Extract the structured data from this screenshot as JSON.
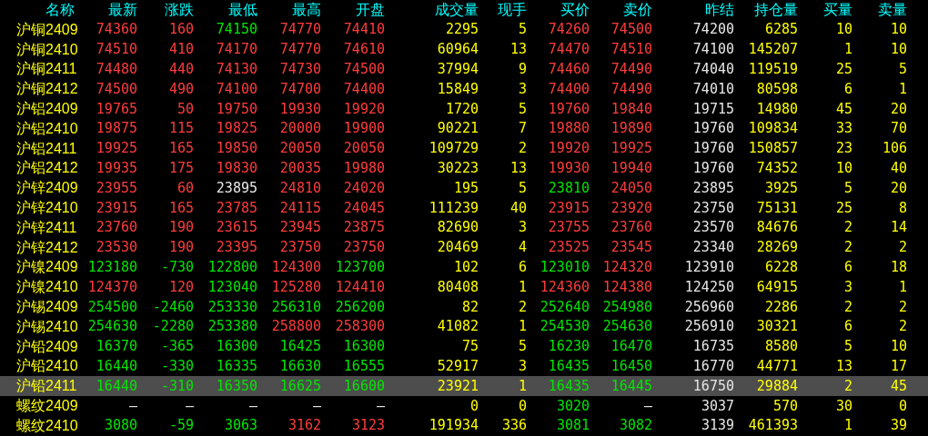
{
  "columns": [
    {
      "label": "名称",
      "kind": "name"
    },
    {
      "label": "最新",
      "kind": "price"
    },
    {
      "label": "涨跌",
      "kind": "price"
    },
    {
      "label": "最低",
      "kind": "price"
    },
    {
      "label": "最高",
      "kind": "price"
    },
    {
      "label": "开盘",
      "kind": "price"
    },
    {
      "label": "成交量",
      "kind": "qty"
    },
    {
      "label": "现手",
      "kind": "qty"
    },
    {
      "label": "买价",
      "kind": "price"
    },
    {
      "label": "卖价",
      "kind": "price"
    },
    {
      "label": "昨结",
      "kind": "ref"
    },
    {
      "label": "持仓量",
      "kind": "qty"
    },
    {
      "label": "买量",
      "kind": "qty"
    },
    {
      "label": "卖量",
      "kind": "qty"
    }
  ],
  "rows": [
    {
      "name": "沪铜2409",
      "selected": false,
      "cells": [
        {
          "text": "74360",
          "color": "#ff3c3c"
        },
        {
          "text": "160",
          "color": "#ff3c3c"
        },
        {
          "text": "74150",
          "color": "#00e600"
        },
        {
          "text": "74770",
          "color": "#ff3c3c"
        },
        {
          "text": "74410",
          "color": "#ff3c3c"
        },
        {
          "text": "2295"
        },
        {
          "text": "5"
        },
        {
          "text": "74260",
          "color": "#ff3c3c"
        },
        {
          "text": "74500",
          "color": "#ff3c3c"
        },
        {
          "text": "74200"
        },
        {
          "text": "6285"
        },
        {
          "text": "10"
        },
        {
          "text": "10"
        }
      ]
    },
    {
      "name": "沪铜2410",
      "selected": false,
      "cells": [
        {
          "text": "74510",
          "color": "#ff3c3c"
        },
        {
          "text": "410",
          "color": "#ff3c3c"
        },
        {
          "text": "74170",
          "color": "#ff3c3c"
        },
        {
          "text": "74770",
          "color": "#ff3c3c"
        },
        {
          "text": "74610",
          "color": "#ff3c3c"
        },
        {
          "text": "60964"
        },
        {
          "text": "13"
        },
        {
          "text": "74470",
          "color": "#ff3c3c"
        },
        {
          "text": "74510",
          "color": "#ff3c3c"
        },
        {
          "text": "74100"
        },
        {
          "text": "145207"
        },
        {
          "text": "1"
        },
        {
          "text": "10"
        }
      ]
    },
    {
      "name": "沪铜2411",
      "selected": false,
      "cells": [
        {
          "text": "74480",
          "color": "#ff3c3c"
        },
        {
          "text": "440",
          "color": "#ff3c3c"
        },
        {
          "text": "74130",
          "color": "#ff3c3c"
        },
        {
          "text": "74730",
          "color": "#ff3c3c"
        },
        {
          "text": "74500",
          "color": "#ff3c3c"
        },
        {
          "text": "37994"
        },
        {
          "text": "9"
        },
        {
          "text": "74460",
          "color": "#ff3c3c"
        },
        {
          "text": "74490",
          "color": "#ff3c3c"
        },
        {
          "text": "74040"
        },
        {
          "text": "119519"
        },
        {
          "text": "25"
        },
        {
          "text": "5"
        }
      ]
    },
    {
      "name": "沪铜2412",
      "selected": false,
      "cells": [
        {
          "text": "74500",
          "color": "#ff3c3c"
        },
        {
          "text": "490",
          "color": "#ff3c3c"
        },
        {
          "text": "74100",
          "color": "#ff3c3c"
        },
        {
          "text": "74700",
          "color": "#ff3c3c"
        },
        {
          "text": "74400",
          "color": "#ff3c3c"
        },
        {
          "text": "15849"
        },
        {
          "text": "3"
        },
        {
          "text": "74400",
          "color": "#ff3c3c"
        },
        {
          "text": "74490",
          "color": "#ff3c3c"
        },
        {
          "text": "74010"
        },
        {
          "text": "80598"
        },
        {
          "text": "6"
        },
        {
          "text": "1"
        }
      ]
    },
    {
      "name": "沪铝2409",
      "selected": false,
      "cells": [
        {
          "text": "19765",
          "color": "#ff3c3c"
        },
        {
          "text": "50",
          "color": "#ff3c3c"
        },
        {
          "text": "19750",
          "color": "#ff3c3c"
        },
        {
          "text": "19930",
          "color": "#ff3c3c"
        },
        {
          "text": "19920",
          "color": "#ff3c3c"
        },
        {
          "text": "1720"
        },
        {
          "text": "5"
        },
        {
          "text": "19760",
          "color": "#ff3c3c"
        },
        {
          "text": "19840",
          "color": "#ff3c3c"
        },
        {
          "text": "19715"
        },
        {
          "text": "14980"
        },
        {
          "text": "45"
        },
        {
          "text": "20"
        }
      ]
    },
    {
      "name": "沪铝2410",
      "selected": false,
      "cells": [
        {
          "text": "19875",
          "color": "#ff3c3c"
        },
        {
          "text": "115",
          "color": "#ff3c3c"
        },
        {
          "text": "19825",
          "color": "#ff3c3c"
        },
        {
          "text": "20000",
          "color": "#ff3c3c"
        },
        {
          "text": "19900",
          "color": "#ff3c3c"
        },
        {
          "text": "90221"
        },
        {
          "text": "7"
        },
        {
          "text": "19880",
          "color": "#ff3c3c"
        },
        {
          "text": "19890",
          "color": "#ff3c3c"
        },
        {
          "text": "19760"
        },
        {
          "text": "109834"
        },
        {
          "text": "33"
        },
        {
          "text": "70"
        }
      ]
    },
    {
      "name": "沪铝2411",
      "selected": false,
      "cells": [
        {
          "text": "19925",
          "color": "#ff3c3c"
        },
        {
          "text": "165",
          "color": "#ff3c3c"
        },
        {
          "text": "19850",
          "color": "#ff3c3c"
        },
        {
          "text": "20050",
          "color": "#ff3c3c"
        },
        {
          "text": "20050",
          "color": "#ff3c3c"
        },
        {
          "text": "109729"
        },
        {
          "text": "2"
        },
        {
          "text": "19920",
          "color": "#ff3c3c"
        },
        {
          "text": "19925",
          "color": "#ff3c3c"
        },
        {
          "text": "19760"
        },
        {
          "text": "150857"
        },
        {
          "text": "23"
        },
        {
          "text": "106"
        }
      ]
    },
    {
      "name": "沪铝2412",
      "selected": false,
      "cells": [
        {
          "text": "19935",
          "color": "#ff3c3c"
        },
        {
          "text": "175",
          "color": "#ff3c3c"
        },
        {
          "text": "19830",
          "color": "#ff3c3c"
        },
        {
          "text": "20035",
          "color": "#ff3c3c"
        },
        {
          "text": "19980",
          "color": "#ff3c3c"
        },
        {
          "text": "30223"
        },
        {
          "text": "13"
        },
        {
          "text": "19930",
          "color": "#ff3c3c"
        },
        {
          "text": "19940",
          "color": "#ff3c3c"
        },
        {
          "text": "19760"
        },
        {
          "text": "74352"
        },
        {
          "text": "10"
        },
        {
          "text": "40"
        }
      ]
    },
    {
      "name": "沪锌2409",
      "selected": false,
      "cells": [
        {
          "text": "23955",
          "color": "#ff3c3c"
        },
        {
          "text": "60",
          "color": "#ff3c3c"
        },
        {
          "text": "23895",
          "color": "#e6e6e6"
        },
        {
          "text": "24810",
          "color": "#ff3c3c"
        },
        {
          "text": "24020",
          "color": "#ff3c3c"
        },
        {
          "text": "195"
        },
        {
          "text": "5"
        },
        {
          "text": "23810",
          "color": "#00e600"
        },
        {
          "text": "24050",
          "color": "#ff3c3c"
        },
        {
          "text": "23895"
        },
        {
          "text": "3925"
        },
        {
          "text": "5"
        },
        {
          "text": "20"
        }
      ]
    },
    {
      "name": "沪锌2410",
      "selected": false,
      "cells": [
        {
          "text": "23915",
          "color": "#ff3c3c"
        },
        {
          "text": "165",
          "color": "#ff3c3c"
        },
        {
          "text": "23785",
          "color": "#ff3c3c"
        },
        {
          "text": "24115",
          "color": "#ff3c3c"
        },
        {
          "text": "24045",
          "color": "#ff3c3c"
        },
        {
          "text": "111239"
        },
        {
          "text": "40"
        },
        {
          "text": "23915",
          "color": "#ff3c3c"
        },
        {
          "text": "23920",
          "color": "#ff3c3c"
        },
        {
          "text": "23750"
        },
        {
          "text": "75131"
        },
        {
          "text": "25"
        },
        {
          "text": "8"
        }
      ]
    },
    {
      "name": "沪锌2411",
      "selected": false,
      "cells": [
        {
          "text": "23760",
          "color": "#ff3c3c"
        },
        {
          "text": "190",
          "color": "#ff3c3c"
        },
        {
          "text": "23615",
          "color": "#ff3c3c"
        },
        {
          "text": "23945",
          "color": "#ff3c3c"
        },
        {
          "text": "23875",
          "color": "#ff3c3c"
        },
        {
          "text": "82690"
        },
        {
          "text": "3"
        },
        {
          "text": "23755",
          "color": "#ff3c3c"
        },
        {
          "text": "23760",
          "color": "#ff3c3c"
        },
        {
          "text": "23570"
        },
        {
          "text": "84676"
        },
        {
          "text": "2"
        },
        {
          "text": "14"
        }
      ]
    },
    {
      "name": "沪锌2412",
      "selected": false,
      "cells": [
        {
          "text": "23530",
          "color": "#ff3c3c"
        },
        {
          "text": "190",
          "color": "#ff3c3c"
        },
        {
          "text": "23395",
          "color": "#ff3c3c"
        },
        {
          "text": "23750",
          "color": "#ff3c3c"
        },
        {
          "text": "23750",
          "color": "#ff3c3c"
        },
        {
          "text": "20469"
        },
        {
          "text": "4"
        },
        {
          "text": "23525",
          "color": "#ff3c3c"
        },
        {
          "text": "23545",
          "color": "#ff3c3c"
        },
        {
          "text": "23340"
        },
        {
          "text": "28269"
        },
        {
          "text": "2"
        },
        {
          "text": "2"
        }
      ]
    },
    {
      "name": "沪镍2409",
      "selected": false,
      "cells": [
        {
          "text": "123180",
          "color": "#00e600"
        },
        {
          "text": "-730",
          "color": "#00e600"
        },
        {
          "text": "122800",
          "color": "#00e600"
        },
        {
          "text": "124300",
          "color": "#ff3c3c"
        },
        {
          "text": "123700",
          "color": "#00e600"
        },
        {
          "text": "102"
        },
        {
          "text": "6"
        },
        {
          "text": "123010",
          "color": "#00e600"
        },
        {
          "text": "124320",
          "color": "#ff3c3c"
        },
        {
          "text": "123910"
        },
        {
          "text": "6228"
        },
        {
          "text": "6"
        },
        {
          "text": "18"
        }
      ]
    },
    {
      "name": "沪镍2410",
      "selected": false,
      "cells": [
        {
          "text": "124370",
          "color": "#ff3c3c"
        },
        {
          "text": "120",
          "color": "#ff3c3c"
        },
        {
          "text": "123040",
          "color": "#00e600"
        },
        {
          "text": "125280",
          "color": "#ff3c3c"
        },
        {
          "text": "124410",
          "color": "#ff3c3c"
        },
        {
          "text": "80408"
        },
        {
          "text": "1"
        },
        {
          "text": "124360",
          "color": "#ff3c3c"
        },
        {
          "text": "124380",
          "color": "#ff3c3c"
        },
        {
          "text": "124250"
        },
        {
          "text": "64915"
        },
        {
          "text": "3"
        },
        {
          "text": "1"
        }
      ]
    },
    {
      "name": "沪锡2409",
      "selected": false,
      "cells": [
        {
          "text": "254500",
          "color": "#00e600"
        },
        {
          "text": "-2460",
          "color": "#00e600"
        },
        {
          "text": "253330",
          "color": "#00e600"
        },
        {
          "text": "256310",
          "color": "#00e600"
        },
        {
          "text": "256200",
          "color": "#00e600"
        },
        {
          "text": "82"
        },
        {
          "text": "2"
        },
        {
          "text": "252640",
          "color": "#00e600"
        },
        {
          "text": "254980",
          "color": "#00e600"
        },
        {
          "text": "256960"
        },
        {
          "text": "2286"
        },
        {
          "text": "2"
        },
        {
          "text": "2"
        }
      ]
    },
    {
      "name": "沪锡2410",
      "selected": false,
      "cells": [
        {
          "text": "254630",
          "color": "#00e600"
        },
        {
          "text": "-2280",
          "color": "#00e600"
        },
        {
          "text": "253380",
          "color": "#00e600"
        },
        {
          "text": "258800",
          "color": "#ff3c3c"
        },
        {
          "text": "258300",
          "color": "#ff3c3c"
        },
        {
          "text": "41082"
        },
        {
          "text": "1"
        },
        {
          "text": "254530",
          "color": "#00e600"
        },
        {
          "text": "254630",
          "color": "#00e600"
        },
        {
          "text": "256910"
        },
        {
          "text": "30321"
        },
        {
          "text": "6"
        },
        {
          "text": "2"
        }
      ]
    },
    {
      "name": "沪铅2409",
      "selected": false,
      "cells": [
        {
          "text": "16370",
          "color": "#00e600"
        },
        {
          "text": "-365",
          "color": "#00e600"
        },
        {
          "text": "16300",
          "color": "#00e600"
        },
        {
          "text": "16425",
          "color": "#00e600"
        },
        {
          "text": "16300",
          "color": "#00e600"
        },
        {
          "text": "75"
        },
        {
          "text": "5"
        },
        {
          "text": "16230",
          "color": "#00e600"
        },
        {
          "text": "16470",
          "color": "#00e600"
        },
        {
          "text": "16735"
        },
        {
          "text": "8580"
        },
        {
          "text": "5"
        },
        {
          "text": "10"
        }
      ]
    },
    {
      "name": "沪铅2410",
      "selected": false,
      "cells": [
        {
          "text": "16440",
          "color": "#00e600"
        },
        {
          "text": "-330",
          "color": "#00e600"
        },
        {
          "text": "16335",
          "color": "#00e600"
        },
        {
          "text": "16630",
          "color": "#00e600"
        },
        {
          "text": "16555",
          "color": "#00e600"
        },
        {
          "text": "52917"
        },
        {
          "text": "3"
        },
        {
          "text": "16435",
          "color": "#00e600"
        },
        {
          "text": "16450",
          "color": "#00e600"
        },
        {
          "text": "16770"
        },
        {
          "text": "44771"
        },
        {
          "text": "13"
        },
        {
          "text": "17"
        }
      ]
    },
    {
      "name": "沪铅2411",
      "selected": true,
      "cells": [
        {
          "text": "16440",
          "color": "#00e600"
        },
        {
          "text": "-310",
          "color": "#00e600"
        },
        {
          "text": "16350",
          "color": "#00e600"
        },
        {
          "text": "16625",
          "color": "#00e600"
        },
        {
          "text": "16600",
          "color": "#00e600"
        },
        {
          "text": "23921"
        },
        {
          "text": "1"
        },
        {
          "text": "16435",
          "color": "#00e600"
        },
        {
          "text": "16445",
          "color": "#00e600"
        },
        {
          "text": "16750"
        },
        {
          "text": "29884"
        },
        {
          "text": "2"
        },
        {
          "text": "45"
        }
      ]
    },
    {
      "name": "螺纹2409",
      "selected": false,
      "cells": [
        {
          "text": "—",
          "color": "#e6e6e6"
        },
        {
          "text": "—",
          "color": "#e6e6e6"
        },
        {
          "text": "—",
          "color": "#e6e6e6"
        },
        {
          "text": "—",
          "color": "#e6e6e6"
        },
        {
          "text": "—",
          "color": "#e6e6e6"
        },
        {
          "text": "0"
        },
        {
          "text": "0"
        },
        {
          "text": "3020",
          "color": "#00e600"
        },
        {
          "text": "—",
          "color": "#e6e6e6"
        },
        {
          "text": "3037"
        },
        {
          "text": "570"
        },
        {
          "text": "30"
        },
        {
          "text": "0"
        }
      ]
    },
    {
      "name": "螺纹2410",
      "selected": false,
      "cells": [
        {
          "text": "3080",
          "color": "#00e600"
        },
        {
          "text": "-59",
          "color": "#00e600"
        },
        {
          "text": "3063",
          "color": "#00e600"
        },
        {
          "text": "3162",
          "color": "#ff3c3c"
        },
        {
          "text": "3123",
          "color": "#ff3c3c"
        },
        {
          "text": "191934"
        },
        {
          "text": "336"
        },
        {
          "text": "3081",
          "color": "#00e600"
        },
        {
          "text": "3082",
          "color": "#00e600"
        },
        {
          "text": "3139"
        },
        {
          "text": "461393"
        },
        {
          "text": "1"
        },
        {
          "text": "39"
        }
      ]
    }
  ]
}
